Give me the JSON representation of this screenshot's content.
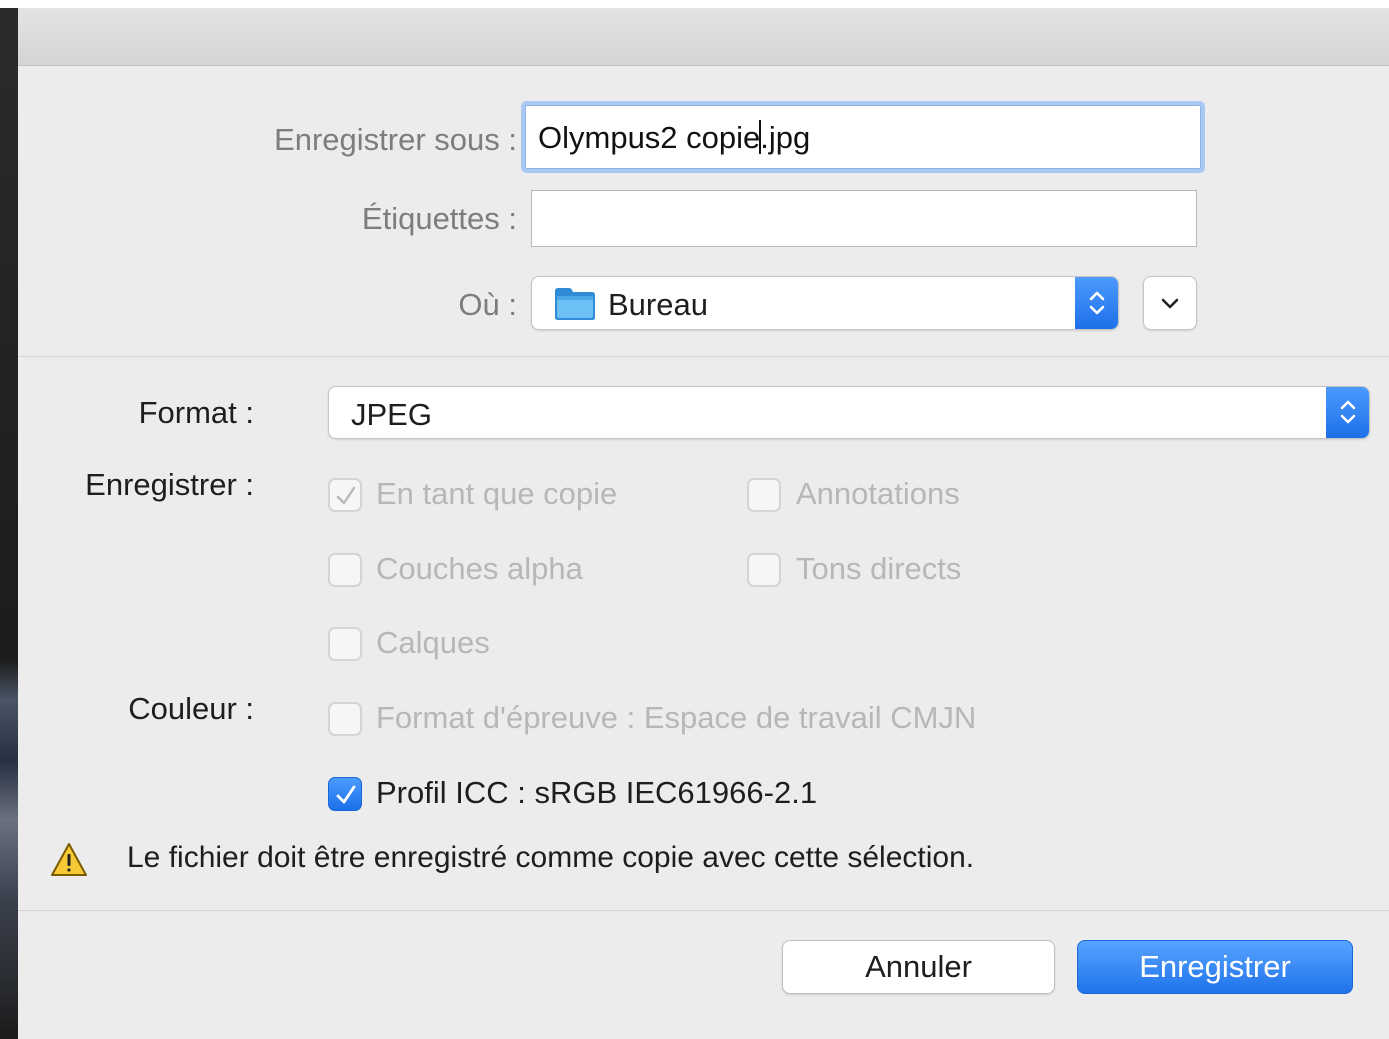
{
  "dialog": {
    "save_as": {
      "label": "Enregistrer sous :",
      "filename_before_caret": "Olympus2 copie",
      "filename_after_caret": ".jpg"
    },
    "tags": {
      "label": "Étiquettes :",
      "value": ""
    },
    "where": {
      "label": "Où :",
      "value": "Bureau",
      "icon": "folder-icon"
    },
    "format": {
      "label": "Format :",
      "value": "JPEG"
    },
    "save_options": {
      "label": "Enregistrer :",
      "items": [
        {
          "label": "En tant que copie",
          "checked": true,
          "enabled": false
        },
        {
          "label": "Annotations",
          "checked": false,
          "enabled": false
        },
        {
          "label": "Couches alpha",
          "checked": false,
          "enabled": false
        },
        {
          "label": "Tons directs",
          "checked": false,
          "enabled": false
        },
        {
          "label": "Calques",
          "checked": false,
          "enabled": false
        }
      ]
    },
    "color": {
      "label": "Couleur :",
      "items": [
        {
          "label": "Format d'épreuve : Espace de travail CMJN",
          "checked": false,
          "enabled": false
        },
        {
          "label": "Profil ICC : sRGB IEC61966-2.1",
          "checked": true,
          "enabled": true
        }
      ]
    },
    "warning": {
      "icon": "warning-icon",
      "text": "Le fichier doit être enregistré comme copie avec cette sélection."
    },
    "buttons": {
      "cancel": "Annuler",
      "save": "Enregistrer"
    },
    "colors": {
      "accent": "#1f73ea",
      "background": "#ececec"
    }
  }
}
